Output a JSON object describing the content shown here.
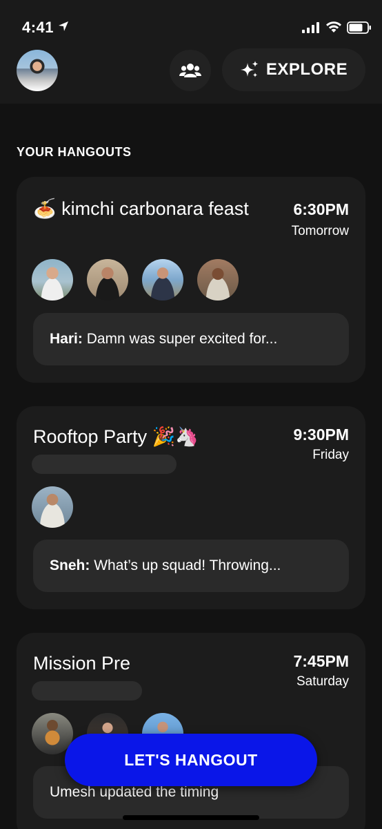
{
  "status_bar": {
    "time": "4:41",
    "icons": [
      "location-arrow-icon",
      "cellular-signal-icon",
      "wifi-icon",
      "battery-icon"
    ]
  },
  "app_bar": {
    "explore_label": "EXPLORE",
    "people_icon": "people-icon",
    "explore_icon": "sparkles-icon"
  },
  "section": {
    "title": "YOUR HANGOUTS"
  },
  "hangouts": [
    {
      "emoji": "🍝",
      "title": "kimchi carbonara feast",
      "time": "6:30PM",
      "day": "Tomorrow",
      "attendee_count": 4,
      "message_author": "Hari:",
      "message_text": "Damn was super excited for..."
    },
    {
      "title": "Rooftop Party 🎉🦄",
      "time": "9:30PM",
      "day": "Friday",
      "attendee_count": 1,
      "message_author": "Sneh:",
      "message_text": "What’s up squad! Throwing..."
    },
    {
      "title": "Mission Pre",
      "time": "7:45PM",
      "day": "Saturday",
      "attendee_count": 3,
      "message_text": "Umesh updated the timing"
    }
  ],
  "cta": {
    "label": "LET'S HANGOUT"
  },
  "colors": {
    "background": "#121212",
    "card": "#1c1c1c",
    "message_box": "#2a2a2a",
    "cta": "#0a16e8"
  }
}
